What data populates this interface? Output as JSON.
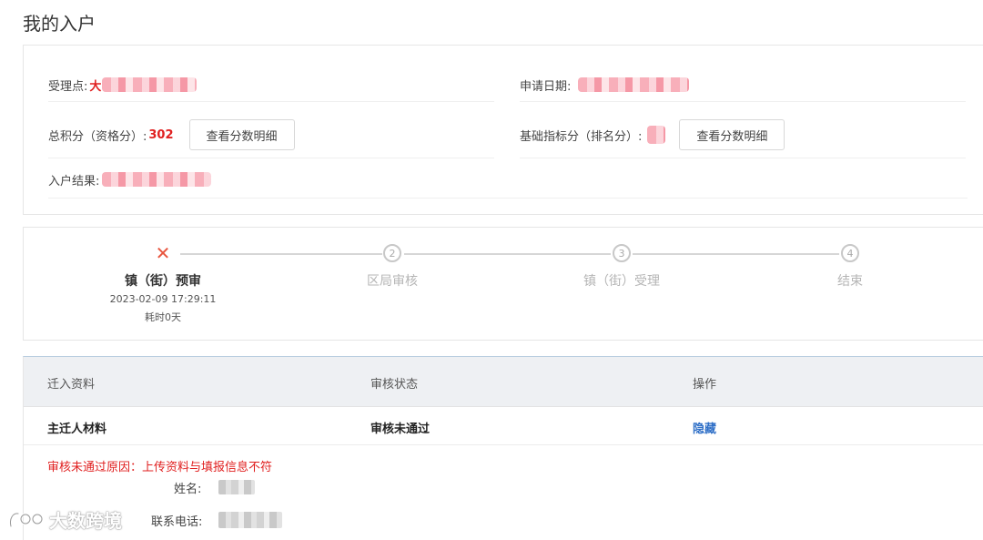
{
  "page_title": "我的入户",
  "info": {
    "accept_point_label": "受理点:",
    "accept_point_prefix": "大",
    "apply_date_label": "申请日期:",
    "total_score_label": "总积分（资格分）:",
    "total_score_value": "302",
    "detail_button_label": "查看分数明细",
    "base_score_label": "基础指标分（排名分）:",
    "result_label": "入户结果:"
  },
  "steps": [
    {
      "label": "镇（街）预审",
      "state": "rejected",
      "icon": "close-icon",
      "date": "2023-02-09 17:29:11",
      "duration": "耗时0天"
    },
    {
      "label": "区局审核",
      "number": "2",
      "state": "pending"
    },
    {
      "label": "镇（街）受理",
      "number": "3",
      "state": "pending"
    },
    {
      "label": "结束",
      "number": "4",
      "state": "pending"
    }
  ],
  "table": {
    "columns": [
      "迁入资料",
      "审核状态",
      "操作"
    ],
    "rows": [
      {
        "material": "主迁人材料",
        "status": "审核未通过",
        "action": "隐藏"
      }
    ],
    "reason": "审核未通过原因：上传资料与填报信息不符",
    "fields": {
      "name_label": "姓名:",
      "phone_label": "联系电话:"
    }
  },
  "watermark": "大数跨境",
  "colors": {
    "accent_red": "#e02020",
    "link_blue": "#2f6fc7",
    "step_reject": "#e8563f"
  }
}
